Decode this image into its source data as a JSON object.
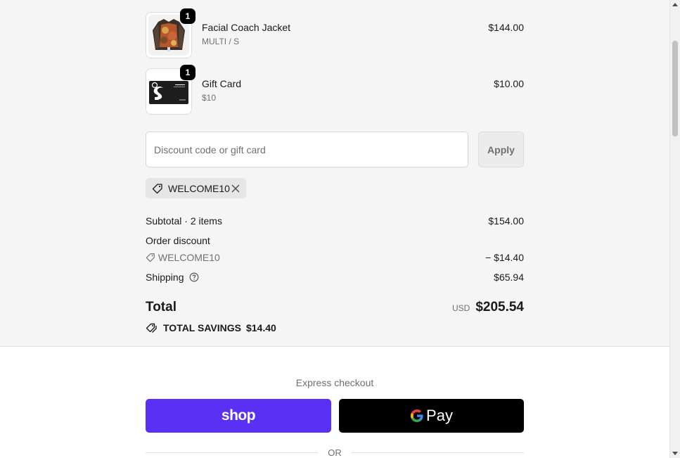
{
  "line_items": [
    {
      "name": "Facial Coach Jacket",
      "variant": "MULTI / S",
      "price": "$144.00",
      "quantity": "1"
    },
    {
      "name": "Gift Card",
      "variant": "$10",
      "price": "$10.00",
      "quantity": "1",
      "card_text": "wtdh"
    }
  ],
  "discount": {
    "placeholder": "Discount code or gift card",
    "value": "",
    "apply_label": "Apply",
    "applied_code": "WELCOME10"
  },
  "summary": {
    "subtotal_label": "Subtotal · 2 items",
    "subtotal_value": "$154.00",
    "order_discount_label": "Order discount",
    "order_discount_code": "WELCOME10",
    "order_discount_value": "− $14.40",
    "shipping_label": "Shipping",
    "shipping_value": "$65.94",
    "total_label": "Total",
    "total_currency": "USD",
    "total_value": "$205.54",
    "savings_label": "TOTAL SAVINGS",
    "savings_value": "$14.40"
  },
  "express": {
    "title": "Express checkout",
    "shop_label": "shop",
    "gpay_label": "Pay",
    "or_label": "OR"
  },
  "colors": {
    "summary_bg": "#f5f5f5",
    "shop_brand": "#5a31f4",
    "gpay_bg": "#000000",
    "muted_text": "#707070"
  },
  "icons": [
    "tag-icon",
    "close-icon",
    "help-circle-icon",
    "savings-tags-icon",
    "google-g-icon"
  ]
}
